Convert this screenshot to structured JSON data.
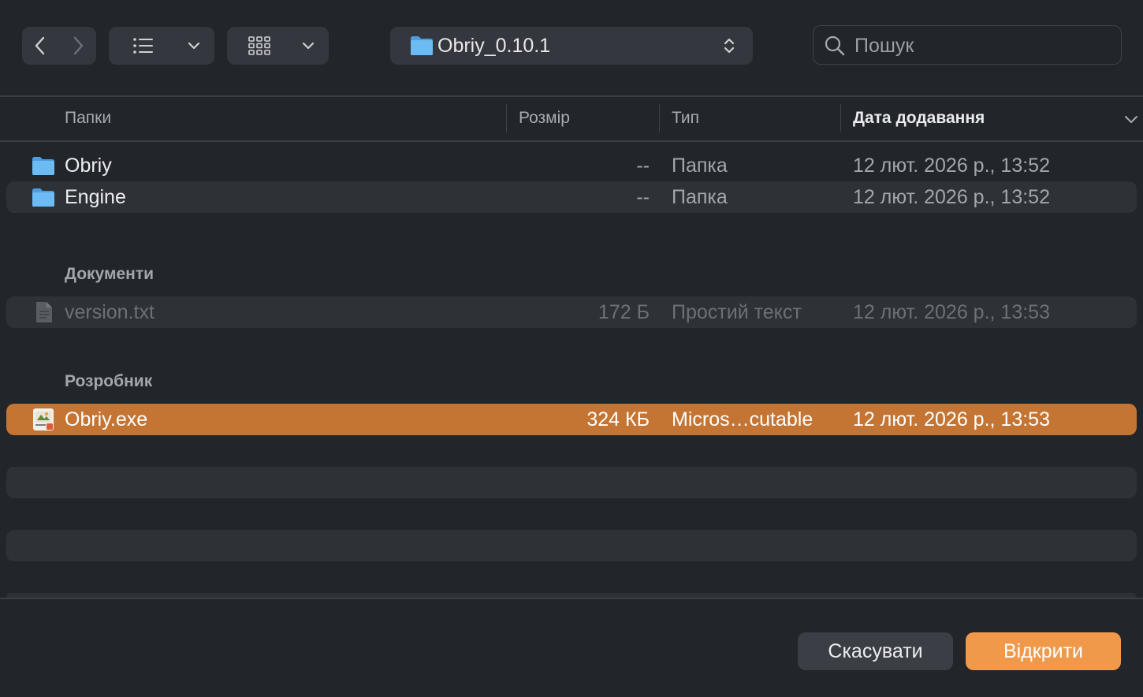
{
  "toolbar": {
    "nav": {
      "back_icon": "chevron-left-icon",
      "forward_icon": "chevron-right-icon"
    },
    "view_list_icon": "list-view-icon",
    "view_grid_icon": "grid-view-icon",
    "path_popup": {
      "icon": "folder-icon",
      "label": "Obriy_0.10.1"
    },
    "search": {
      "placeholder": "Пошук",
      "value": ""
    }
  },
  "columns": {
    "name": "Папки",
    "size": "Розмір",
    "type": "Тип",
    "date": "Дата додавання",
    "sorted_by": "date"
  },
  "folders": [
    {
      "name": "Obriy",
      "size": "--",
      "type": "Папка",
      "date": "12 лют. 2026 р., 13:52",
      "icon": "folder-icon"
    },
    {
      "name": "Engine",
      "size": "--",
      "type": "Папка",
      "date": "12 лют. 2026 р., 13:52",
      "icon": "folder-icon"
    }
  ],
  "groups": {
    "documents": {
      "title": "Документи",
      "items": [
        {
          "name": "version.txt",
          "size": "172 Б",
          "type": "Простий текст",
          "date": "12 лют. 2026 р., 13:53",
          "icon": "text-file-icon",
          "enabled": false
        }
      ]
    },
    "developer": {
      "title": "Розробник",
      "items": [
        {
          "name": "Obriy.exe",
          "size": "324 КБ",
          "type": "Micros…cutable",
          "date": "12 лют. 2026 р., 13:53",
          "icon": "exe-file-icon",
          "selected": true
        }
      ]
    }
  },
  "footer": {
    "cancel_label": "Скасувати",
    "open_label": "Відкрити"
  },
  "colors": {
    "background": "#22252a",
    "selection": "#c47433",
    "primary_button": "#f0994a",
    "folder": "#5fb3ef"
  }
}
